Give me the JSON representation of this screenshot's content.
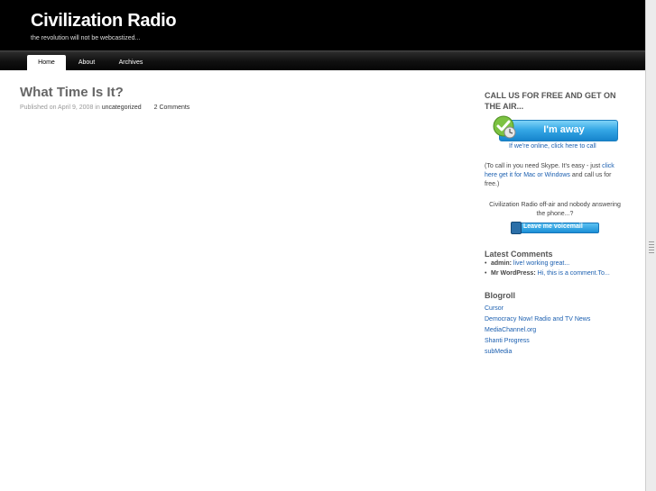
{
  "header": {
    "title": "Civilization Radio",
    "tagline": "the revolution will not be webcastized..."
  },
  "nav": {
    "items": [
      {
        "label": "Home",
        "active": true
      },
      {
        "label": "About",
        "active": false
      },
      {
        "label": "Archives",
        "active": false
      }
    ]
  },
  "post": {
    "title": "What Time Is It?",
    "meta_prefix": "Published on April 9, 2008 in",
    "category": "uncategorized",
    "comments": "2 Comments"
  },
  "sidebar": {
    "callus_heading": "CALL US FOR FREE AND GET ON THE AIR...",
    "skype_button_label": "I'm away",
    "online_link": "If we're online, click here to call",
    "skype_note_prefix": "(To call in you need Skype. It's easy - just",
    "skype_note_link": "click here get it for Mac or Windows",
    "skype_note_suffix": "and call us for free.)",
    "offair_text": "Civilization Radio off-air and nobody answering the phone...?",
    "voicemail_label": "Leave me voicemail",
    "latest_comments_heading": "Latest Comments",
    "latest_comments": [
      {
        "author": "admin:",
        "excerpt": "live! working great..."
      },
      {
        "author": "Mr WordPress:",
        "excerpt": "Hi, this is a comment.To..."
      }
    ],
    "blogroll_heading": "Blogroll",
    "blogroll": [
      "Cursor",
      "Democracy Now! Radio and TV News",
      "MediaChannel.org",
      "Shanti Progress",
      "subMedia"
    ]
  },
  "colors": {
    "header_bg": "#000000",
    "link": "#1b5fb0",
    "skype_blue": "#35a8e6",
    "skype_green": "#7cc242"
  },
  "icons": {
    "skype_status": "green-check-clock-icon",
    "voicemail": "voicemail-icon",
    "scroll_grip": "scrollbar-grip-icon"
  }
}
